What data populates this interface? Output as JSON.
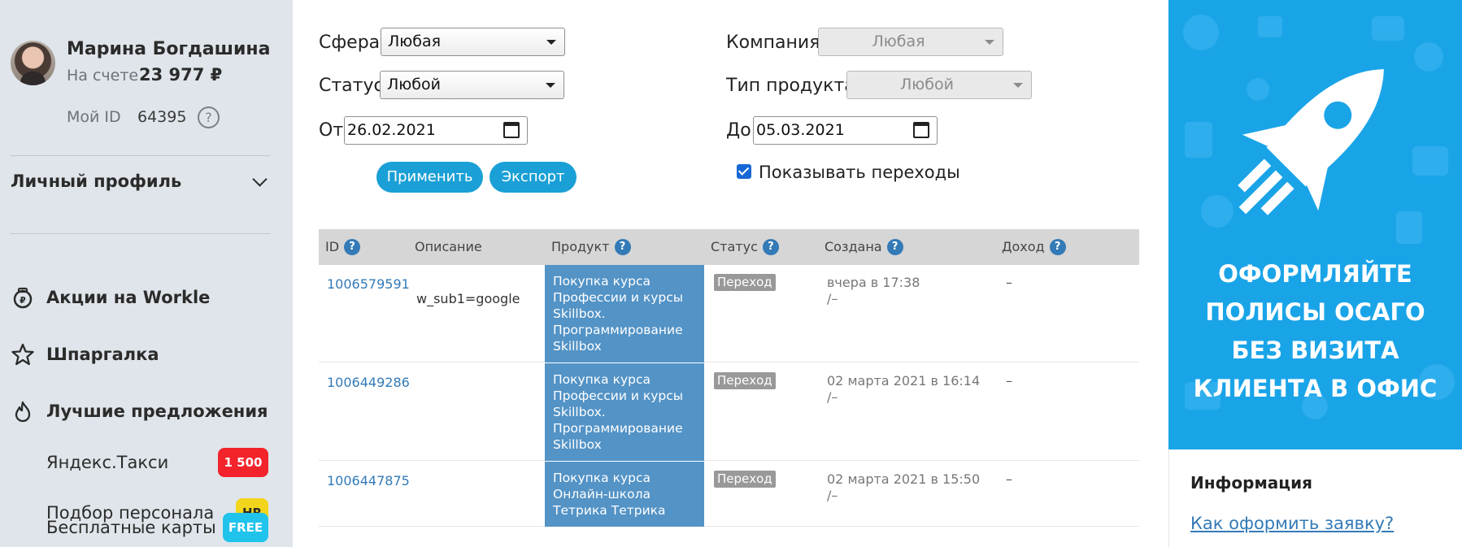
{
  "sidebar": {
    "user_name": "Марина Богдашина",
    "balance_label": "На счете",
    "balance_value": "23 977 ₽",
    "id_label": "Мой ID",
    "id_value": "64395",
    "help_symbol": "?",
    "profile_label": "Личный профиль",
    "nav": [
      {
        "label": "Акции на Workle",
        "icon": "piggy-bank-icon"
      },
      {
        "label": "Шпаргалка",
        "icon": "star-icon"
      },
      {
        "label": "Лучшие предложения",
        "icon": "fire-icon"
      }
    ],
    "offers": [
      {
        "label": "Яндекс.Такси",
        "badge": "1 500",
        "badge_bg": "#f2232b",
        "badge_color": "#ffffff"
      },
      {
        "label": "Подбор персонала",
        "badge": "HR",
        "badge_bg": "#f2d51c",
        "badge_color": "#2b2b2b"
      },
      {
        "label": "Бесплатные карты",
        "badge": "FREE",
        "badge_bg": "#20c3ec",
        "badge_color": "#ffffff"
      }
    ]
  },
  "filters": {
    "sphere_label": "Сфера",
    "sphere_value": "Любая",
    "status_label": "Статус",
    "status_value": "Любой",
    "from_label": "От",
    "from_value": "26.02.2021",
    "company_label": "Компания",
    "company_value": "Любая",
    "product_type_label": "Тип продукта",
    "product_type_value": "Любой",
    "to_label": "До",
    "to_value": "05.03.2021",
    "apply_label": "Применить",
    "export_label": "Экспорт",
    "show_transitions_label": "Показывать переходы",
    "show_transitions_checked": true
  },
  "table": {
    "headers": {
      "id": "ID",
      "description": "Описание",
      "product": "Продукт",
      "status": "Статус",
      "created": "Создана",
      "income": "Доход",
      "help_symbol": "?"
    },
    "rows": [
      {
        "id": "1006579591",
        "description": "w_sub1=google",
        "product": "Покупка курса Профессии и курсы Skillbox. Программирование Skillbox",
        "status": "Переход",
        "created_line1": "вчера в 17:38",
        "created_line2": "/–",
        "income": "–"
      },
      {
        "id": "1006449286",
        "description": "",
        "product": "Покупка курса Профессии и курсы Skillbox. Программирование Skillbox",
        "status": "Переход",
        "created_line1": "02 марта 2021 в 16:14",
        "created_line2": "/–",
        "income": "–"
      },
      {
        "id": "1006447875",
        "description": "",
        "product": "Покупка курса Онлайн-школа Тетрика Тетрика",
        "status": "Переход",
        "created_line1": "02 марта 2021 в 15:50",
        "created_line2": "/–",
        "income": "–"
      }
    ]
  },
  "ad": {
    "lines": [
      "ОФОРМЛЯЙТЕ",
      "ПОЛИСЫ ОСАГО",
      "БЕЗ ВИЗИТА",
      "КЛИЕНТА В ОФИС"
    ],
    "icon": "rocket-icon",
    "bg_color": "#1aa4e8"
  },
  "info": {
    "title": "Информация",
    "link": "Как оформить заявку?"
  }
}
